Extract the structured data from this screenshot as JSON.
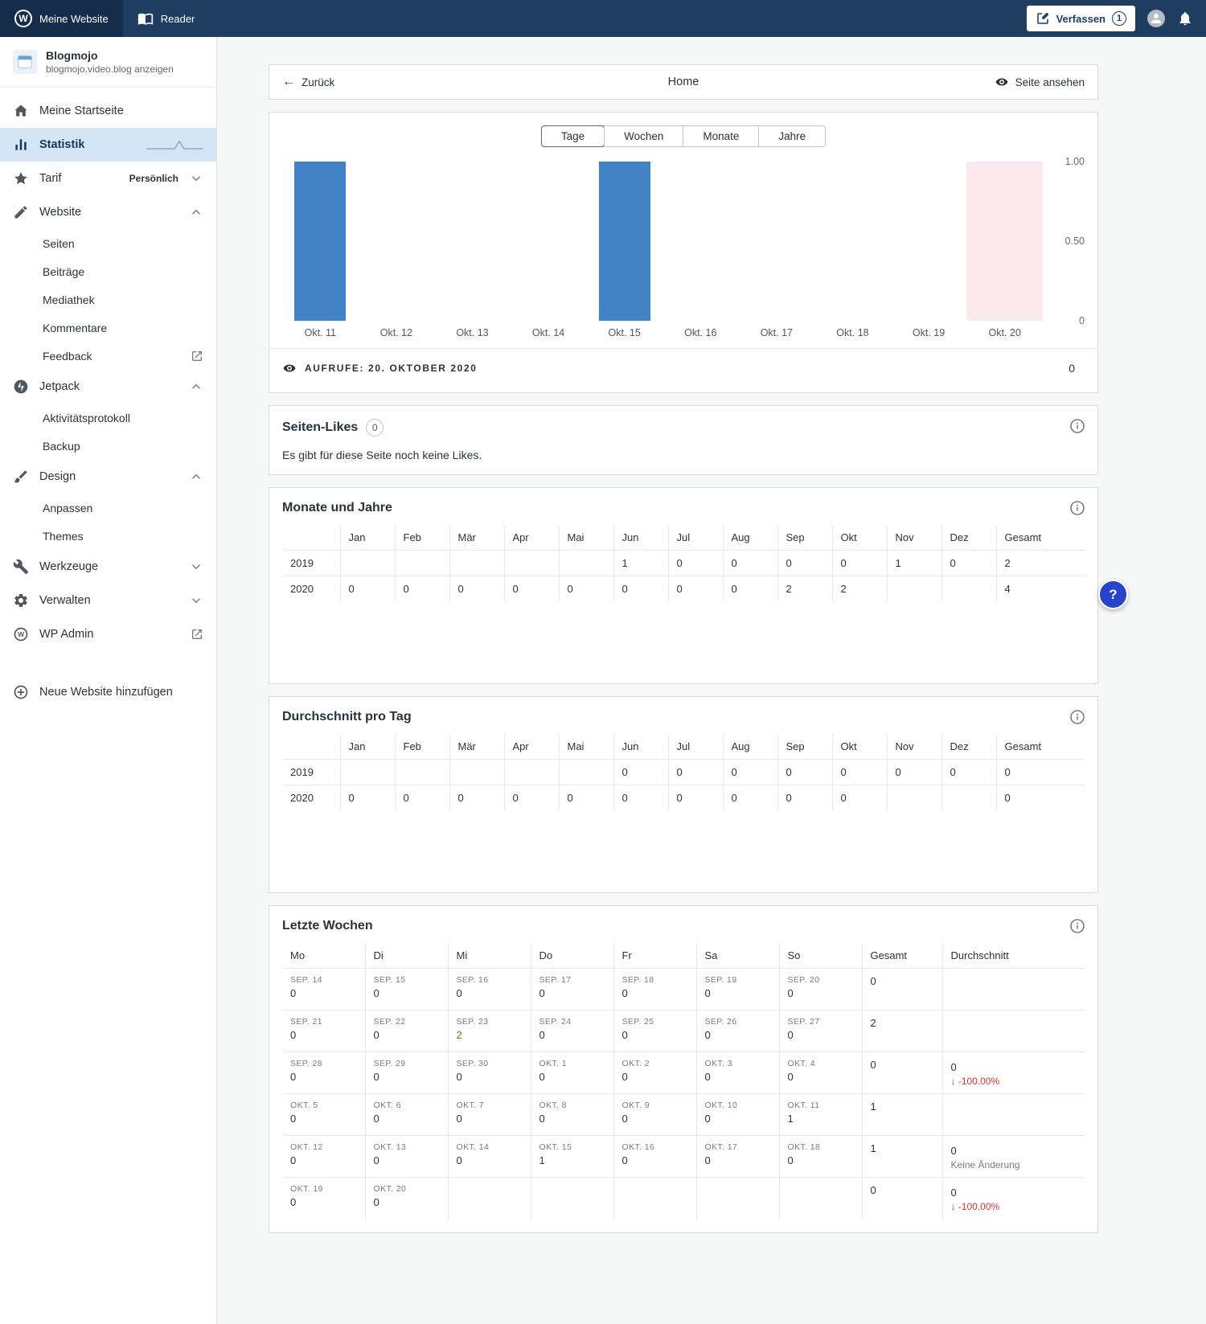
{
  "colors": {
    "masterbar-bg": "#1f3c61",
    "masterbar-active": "#152c4a",
    "bar": "#4183c4",
    "chart-sel": "#fbe9ed",
    "sb-sel-bg": "#d5e5f5",
    "sb-sel-tx": "#14395f",
    "amber": "#9d6e00",
    "red": "#d63638",
    "fab": "#2743c8",
    "accent": "#0675c4"
  },
  "masterbar": {
    "my_site": "Meine Website",
    "reader": "Reader",
    "compose": "Verfassen",
    "compose_badge": "1"
  },
  "sidebar": {
    "site_name": "Blogmojo",
    "site_link": "blogmojo.video.blog anzeigen",
    "items": [
      {
        "label": "Meine Startseite"
      },
      {
        "label": "Statistik"
      },
      {
        "label": "Tarif",
        "badge": "Persönlich"
      },
      {
        "label": "Website",
        "children": [
          {
            "label": "Seiten"
          },
          {
            "label": "Beiträge"
          },
          {
            "label": "Mediathek"
          },
          {
            "label": "Kommentare"
          },
          {
            "label": "Feedback"
          }
        ]
      },
      {
        "label": "Jetpack",
        "children": [
          {
            "label": "Aktivitätsprotokoll"
          },
          {
            "label": "Backup"
          }
        ]
      },
      {
        "label": "Design",
        "children": [
          {
            "label": "Anpassen"
          },
          {
            "label": "Themes"
          }
        ]
      },
      {
        "label": "Werkzeuge"
      },
      {
        "label": "Verwalten"
      },
      {
        "label": "WP Admin"
      }
    ],
    "add_site": "Neue Website hinzufügen"
  },
  "page_header": {
    "back": "Zurück",
    "title": "Home",
    "view_page": "Seite ansehen"
  },
  "stats": {
    "tabs": [
      "Tage",
      "Wochen",
      "Monate",
      "Jahre"
    ],
    "active_tab": "Tage",
    "chart_data": {
      "type": "bar",
      "x": [
        "Okt. 11",
        "Okt. 12",
        "Okt. 13",
        "Okt. 14",
        "Okt. 15",
        "Okt. 16",
        "Okt. 17",
        "Okt. 18",
        "Okt. 19",
        "Okt. 20"
      ],
      "values": [
        1,
        0,
        0,
        0,
        1,
        0,
        0,
        0,
        0,
        0
      ],
      "selected_index": 9,
      "ylim": [
        0,
        1
      ],
      "yticks": [
        "1.00",
        "0.50",
        "0"
      ],
      "series_label": "Aufrufe"
    },
    "footer": {
      "label": "AUFRUFE: 20. OKTOBER 2020",
      "value": "0"
    }
  },
  "likes": {
    "title": "Seiten-Likes",
    "badge": "0",
    "message": "Es gibt für diese Seite noch keine Likes."
  },
  "months_table": {
    "title": "Monate und Jahre",
    "columns": [
      "Jan",
      "Feb",
      "Mär",
      "Apr",
      "Mai",
      "Jun",
      "Jul",
      "Aug",
      "Sep",
      "Okt",
      "Nov",
      "Dez",
      "Gesamt"
    ],
    "rows": [
      {
        "label": "2019",
        "cells": [
          "",
          "",
          "",
          "",
          "",
          "1",
          "0",
          "0",
          "0",
          "0",
          "1",
          "0",
          "2"
        ]
      },
      {
        "label": "2020",
        "cells": [
          "0",
          "0",
          "0",
          "0",
          "0",
          "0",
          "0",
          "0",
          {
            "text": "2",
            "tone": "amber"
          },
          {
            "text": "2",
            "tone": "amber"
          },
          "",
          "",
          "4"
        ]
      }
    ]
  },
  "avg_table": {
    "title": "Durchschnitt pro Tag",
    "columns": [
      "Jan",
      "Feb",
      "Mär",
      "Apr",
      "Mai",
      "Jun",
      "Jul",
      "Aug",
      "Sep",
      "Okt",
      "Nov",
      "Dez",
      "Gesamt"
    ],
    "rows": [
      {
        "label": "2019",
        "cells": [
          "",
          "",
          "",
          "",
          "",
          "0",
          "0",
          "0",
          "0",
          "0",
          "0",
          "0",
          "0"
        ]
      },
      {
        "label": "2020",
        "cells": [
          "0",
          "0",
          "0",
          "0",
          "0",
          "0",
          "0",
          "0",
          "0",
          "0",
          "",
          "",
          "0"
        ]
      }
    ]
  },
  "weeks_table": {
    "title": "Letzte Wochen",
    "columns": [
      "Mo",
      "Di",
      "Mi",
      "Do",
      "Fr",
      "Sa",
      "So",
      "Gesamt",
      "Durchschnitt"
    ],
    "rows": [
      {
        "days": [
          {
            "date": "SEP. 14",
            "value": "0"
          },
          {
            "date": "SEP. 15",
            "value": "0"
          },
          {
            "date": "SEP. 16",
            "value": "0"
          },
          {
            "date": "SEP. 17",
            "value": "0"
          },
          {
            "date": "SEP. 18",
            "value": "0"
          },
          {
            "date": "SEP. 19",
            "value": "0"
          },
          {
            "date": "SEP. 20",
            "value": "0"
          }
        ],
        "total": "0",
        "avg": null
      },
      {
        "days": [
          {
            "date": "SEP. 21",
            "value": "0"
          },
          {
            "date": "SEP. 22",
            "value": "0"
          },
          {
            "date": "SEP. 23",
            "value": "2",
            "tone": "amber"
          },
          {
            "date": "SEP. 24",
            "value": "0"
          },
          {
            "date": "SEP. 25",
            "value": "0"
          },
          {
            "date": "SEP. 26",
            "value": "0"
          },
          {
            "date": "SEP. 27",
            "value": "0"
          }
        ],
        "total": "2",
        "avg": null
      },
      {
        "days": [
          {
            "date": "SEP. 28",
            "value": "0"
          },
          {
            "date": "SEP. 29",
            "value": "0"
          },
          {
            "date": "SEP. 30",
            "value": "0"
          },
          {
            "date": "OKT. 1",
            "value": "0"
          },
          {
            "date": "OKT. 2",
            "value": "0"
          },
          {
            "date": "OKT. 3",
            "value": "0"
          },
          {
            "date": "OKT. 4",
            "value": "0"
          }
        ],
        "total": "0",
        "avg": {
          "value": "0",
          "change": "-100.00%",
          "direction": "down"
        }
      },
      {
        "days": [
          {
            "date": "OKT. 5",
            "value": "0"
          },
          {
            "date": "OKT. 6",
            "value": "0"
          },
          {
            "date": "OKT. 7",
            "value": "0"
          },
          {
            "date": "OKT. 8",
            "value": "0"
          },
          {
            "date": "OKT. 9",
            "value": "0"
          },
          {
            "date": "OKT. 10",
            "value": "0"
          },
          {
            "date": "OKT. 11",
            "value": "1"
          }
        ],
        "total": "1",
        "avg": null
      },
      {
        "days": [
          {
            "date": "OKT. 12",
            "value": "0"
          },
          {
            "date": "OKT. 13",
            "value": "0"
          },
          {
            "date": "OKT. 14",
            "value": "0"
          },
          {
            "date": "OKT. 15",
            "value": "1"
          },
          {
            "date": "OKT. 16",
            "value": "0"
          },
          {
            "date": "OKT. 17",
            "value": "0"
          },
          {
            "date": "OKT. 18",
            "value": "0"
          }
        ],
        "total": "1",
        "avg": {
          "value": "0",
          "change": "Keine Änderung",
          "direction": "none"
        }
      },
      {
        "days": [
          {
            "date": "OKT. 19",
            "value": "0"
          },
          {
            "date": "OKT. 20",
            "value": "0"
          }
        ],
        "total": "0",
        "avg": {
          "value": "0",
          "change": "-100.00%",
          "direction": "down"
        }
      }
    ]
  },
  "help": {
    "label": "?"
  }
}
